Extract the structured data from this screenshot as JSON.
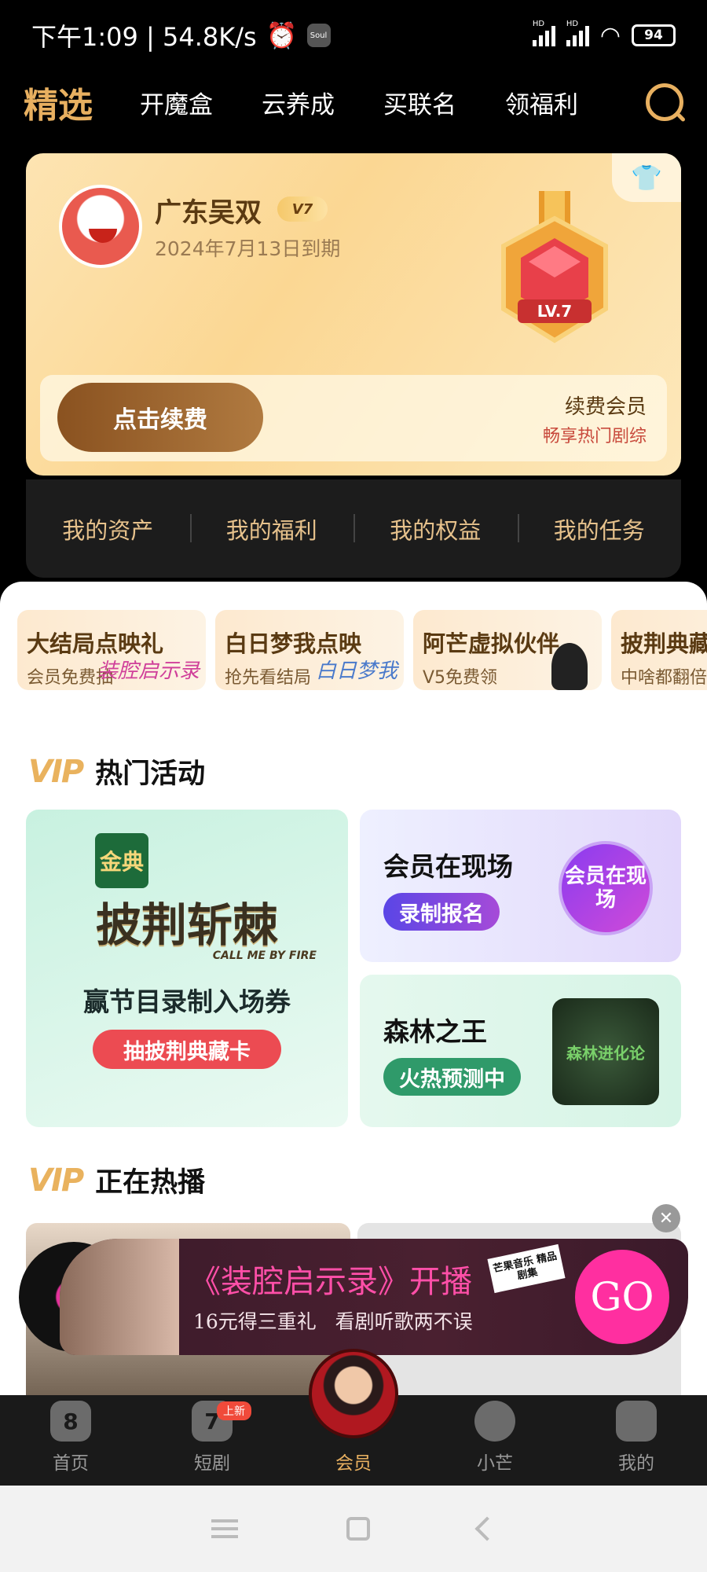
{
  "status": {
    "time_speed": "下午1:09 | 54.8K/s",
    "soul": "Soul",
    "hd1": "HD",
    "hd2": "HD",
    "battery": "94"
  },
  "topnav": {
    "active": "精选",
    "tabs": [
      "开魔盒",
      "云养成",
      "买联名",
      "领福利"
    ]
  },
  "vip_card": {
    "user_name": "广东吴双",
    "vip_level": "V7",
    "expire": "2024年7月13日到期",
    "medal_level": "LV.7",
    "renew_button": "点击续费",
    "renew_title": "续费会员",
    "renew_subtitle": "畅享热门剧综"
  },
  "my_row": [
    "我的资产",
    "我的福利",
    "我的权益",
    "我的任务"
  ],
  "promos": [
    {
      "title": "大结局点映礼",
      "sub": "会员免费抽",
      "deco": "装腔启示录"
    },
    {
      "title": "白日梦我点映",
      "sub": "抢先看结局",
      "deco": "白日梦我"
    },
    {
      "title": "阿芒虚拟伙伴",
      "sub": "V5免费领",
      "deco": ""
    },
    {
      "title": "披荆典藏",
      "sub": "中啥都翻倍",
      "deco": ""
    }
  ],
  "hot_activities": {
    "vip_logo": "VIP",
    "title": "热门活动",
    "big_card": {
      "brand": "金典",
      "show": "披荆斩棘",
      "show_en": "CALL ME BY FIRE",
      "desc": "赢节目录制入场券",
      "button": "抽披荆典藏卡"
    },
    "card1": {
      "title": "会员在现场",
      "pill": "录制报名",
      "badge": "会员在现场"
    },
    "card2": {
      "title": "森林之王",
      "pill": "火热预测中",
      "poster": "森林进化论"
    }
  },
  "now_playing": {
    "vip_logo": "VIP",
    "title": "正在热播"
  },
  "ad": {
    "title": "《装腔启示录》开播",
    "subtitle": "16元得三重礼   看剧听歌两不误",
    "tag": "芒果音乐 精品剧集",
    "go": "GO",
    "close": "✕"
  },
  "tabbar": {
    "items": [
      "首页",
      "短剧",
      "会员",
      "小芒",
      "我的"
    ],
    "new_badge": "上新",
    "short_icon_text": "7"
  },
  "colors": {
    "gold": "#e8b060",
    "background": "#000000"
  }
}
